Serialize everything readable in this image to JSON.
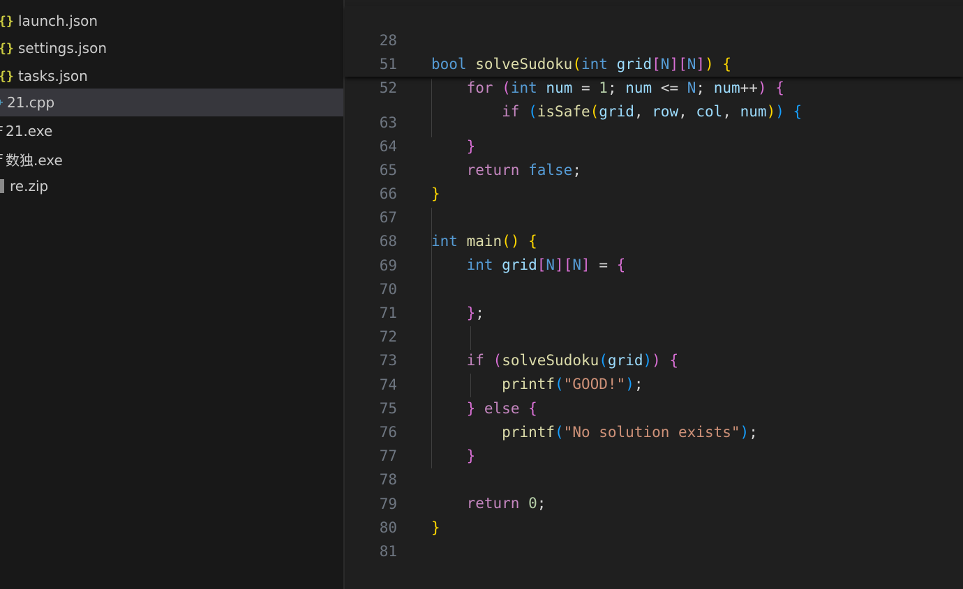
{
  "explorer": {
    "files": [
      {
        "name": "launch.json",
        "icon": "json-braces-icon",
        "glyph": "{}"
      },
      {
        "name": "settings.json",
        "icon": "json-braces-icon",
        "glyph": "{}"
      },
      {
        "name": "tasks.json",
        "icon": "json-braces-icon",
        "glyph": "{}"
      },
      {
        "name": "21.cpp",
        "icon": "cpp-file-icon",
        "glyph": "+",
        "active": true
      },
      {
        "name": "21.exe",
        "icon": "exe-file-icon",
        "glyph": "F"
      },
      {
        "name": "数独.exe",
        "icon": "exe-file-icon",
        "glyph": "F"
      },
      {
        "name": "re.zip",
        "icon": "zip-file-icon",
        "glyph": ""
      }
    ]
  },
  "editor": {
    "sticky_lines": [
      {
        "num": "28",
        "text": "bool solveSudoku(int grid[N][N]) {"
      },
      {
        "num": "51",
        "text": "    for (int num = 1; num <= N; num++) {"
      },
      {
        "num": "52",
        "text": "        if (isSafe(grid, row, col, num)) {"
      }
    ],
    "lines": [
      {
        "num": "63",
        "text": "    }"
      },
      {
        "num": "64",
        "text": "    return false;"
      },
      {
        "num": "65",
        "text": "}"
      },
      {
        "num": "66",
        "text": ""
      },
      {
        "num": "67",
        "text": "int main() {"
      },
      {
        "num": "68",
        "text": "    int grid[N][N] = {"
      },
      {
        "num": "69",
        "text": ""
      },
      {
        "num": "70",
        "text": "    };"
      },
      {
        "num": "71",
        "text": ""
      },
      {
        "num": "72",
        "text": "    if (solveSudoku(grid)) {"
      },
      {
        "num": "73",
        "text": "        printf(\"GOOD!\");"
      },
      {
        "num": "74",
        "text": "    } else {"
      },
      {
        "num": "75",
        "text": "        printf(\"No solution exists\");"
      },
      {
        "num": "76",
        "text": "    }"
      },
      {
        "num": "77",
        "text": ""
      },
      {
        "num": "78",
        "text": "    return 0;"
      },
      {
        "num": "79",
        "text": "}"
      },
      {
        "num": "80",
        "text": ""
      },
      {
        "num": "81",
        "text": ""
      }
    ]
  },
  "colors": {
    "sidebar_bg": "#181818",
    "editor_bg": "#1f1f1f",
    "active_row": "#37373d",
    "keyword": "#569cd6",
    "control": "#c586c0",
    "function": "#dcdcaa",
    "variable": "#9cdcfe",
    "string": "#ce9178",
    "number": "#b5cea8"
  }
}
